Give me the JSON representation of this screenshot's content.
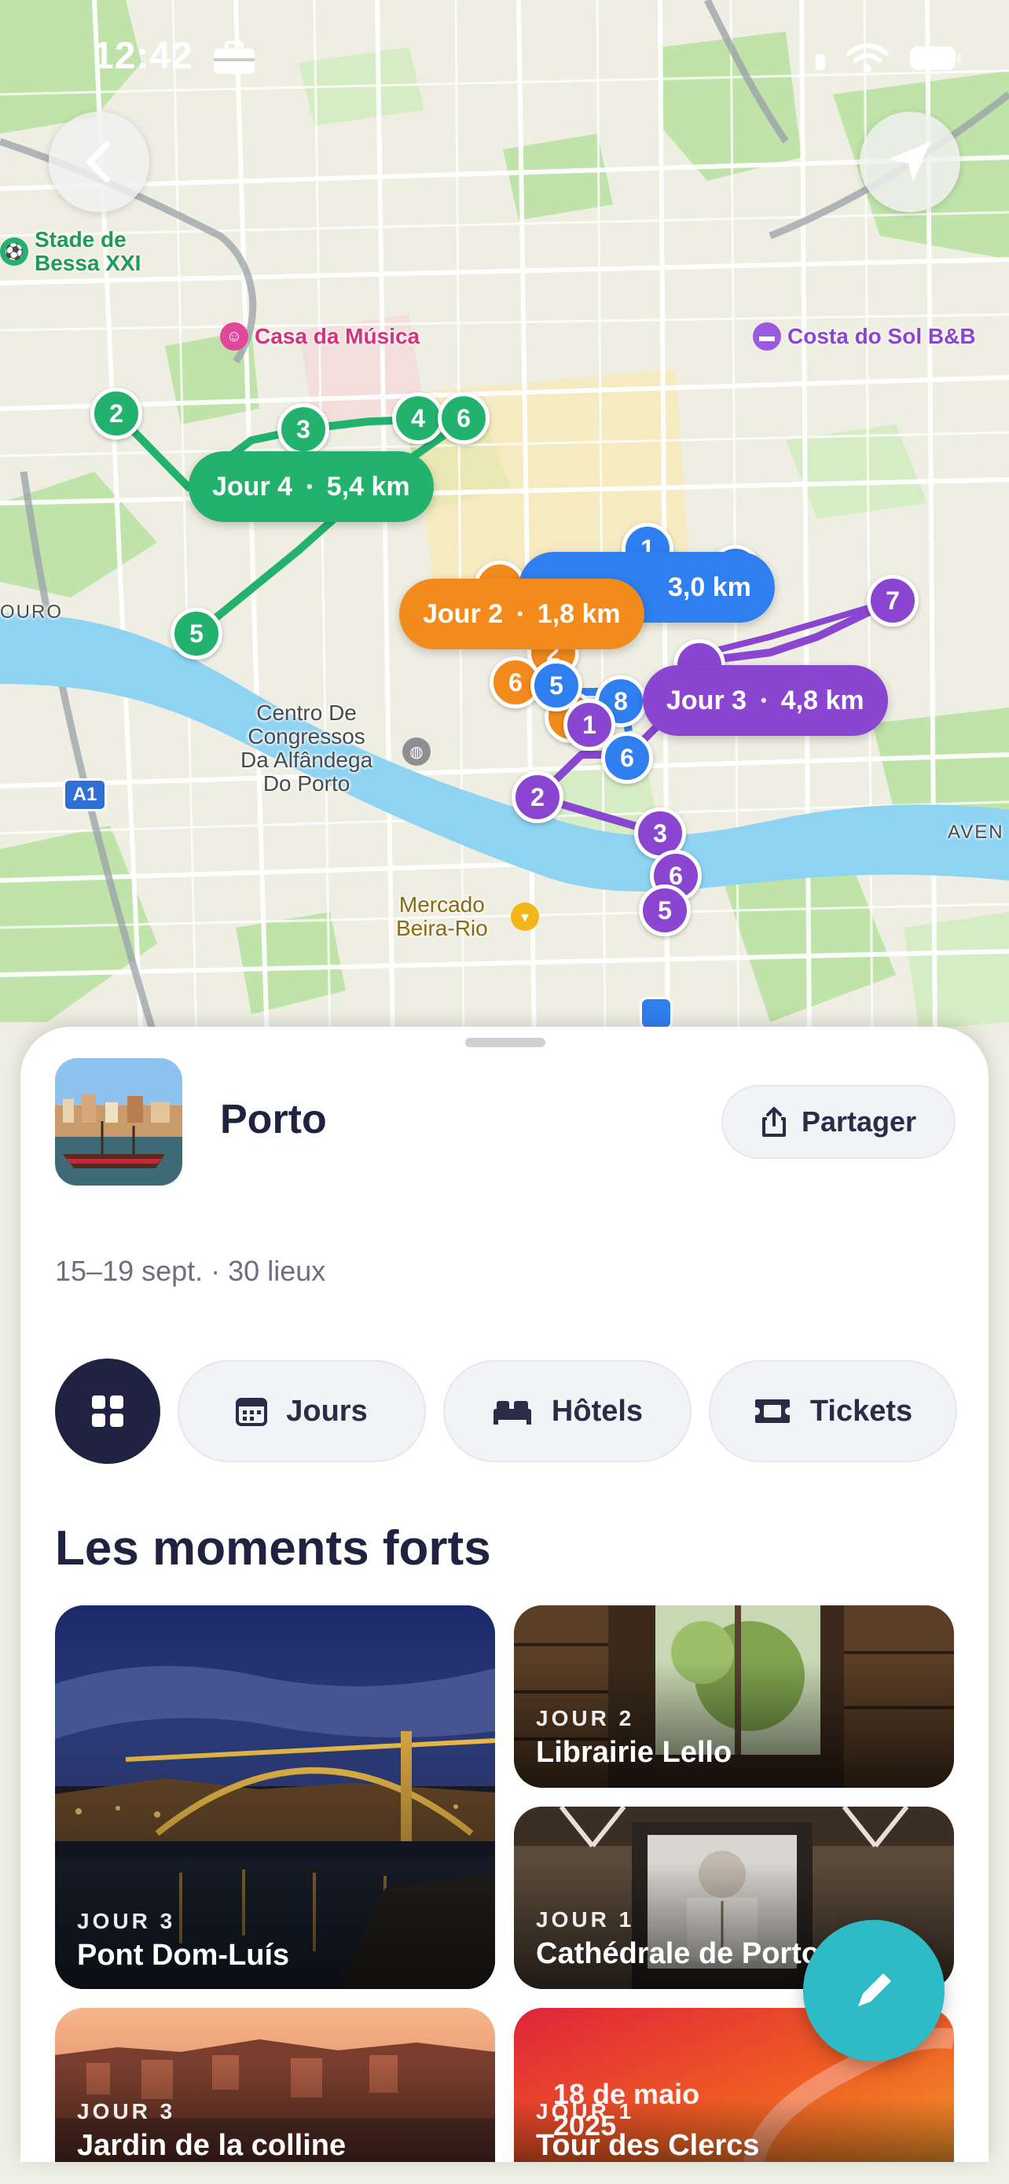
{
  "status_bar": {
    "time": "12:42"
  },
  "map": {
    "labels": {
      "stadium": "Stade de\nBessa XXI",
      "casa_musica": "Casa da Música",
      "costa_sol": "Costa do Sol B&B",
      "centro": "Centro De\nCongressos\nDa Alfândega\nDo Porto",
      "mercado": "Mercado\nBeira-Rio",
      "douro": "OURO",
      "highway": "A1",
      "aven": "AVEN"
    },
    "routes": [
      {
        "day": "Jour 4",
        "distance": "5,4 km",
        "color": "#23b26d"
      },
      {
        "day": "Jour 2",
        "distance": "1,8 km",
        "color": "#f28a1c"
      },
      {
        "day": "Jour 3",
        "distance": "4,8 km",
        "color": "#8b46d1"
      },
      {
        "distance": "3,0 km",
        "color": "#2f7ff0"
      }
    ],
    "pins": {
      "g2": "2",
      "g3": "3",
      "g4": "4",
      "g6": "6",
      "g5": "5",
      "b1": "1",
      "b6": "6",
      "b5": "5",
      "b8": "8",
      "o6": "6",
      "o2": "2",
      "p7": "7",
      "p1": "1",
      "p2": "2",
      "p3": "3",
      "p6": "6",
      "p5": "5"
    }
  },
  "sheet": {
    "title": "Porto",
    "share_label": "Partager",
    "meta": "15–19 sept. · 30 lieux",
    "tabs": [
      {
        "label": "Jours",
        "icon": "calendar-icon"
      },
      {
        "label": "Hôtels",
        "icon": "bed-icon"
      },
      {
        "label": "Tickets",
        "icon": "ticket-icon"
      }
    ],
    "section_title": "Les moments forts",
    "highlights": [
      {
        "day": "JOUR 3",
        "name": "Pont Dom-Luís"
      },
      {
        "day": "JOUR 2",
        "name": "Librairie Lello"
      },
      {
        "day": "JOUR 1",
        "name": "Cathédrale de Porto"
      },
      {
        "day": "JOUR 3",
        "name": "Jardin de la colline"
      },
      {
        "day": "JOUR 1",
        "name": "Tour des Clercs",
        "overlay_text": "18 de maio\n2025"
      }
    ]
  },
  "colors": {
    "accent": "#2ebbc6",
    "navy": "#1f2240",
    "day1": "#2f7ff0",
    "day2": "#f28a1c",
    "day3": "#8b46d1",
    "day4": "#23b26d"
  }
}
